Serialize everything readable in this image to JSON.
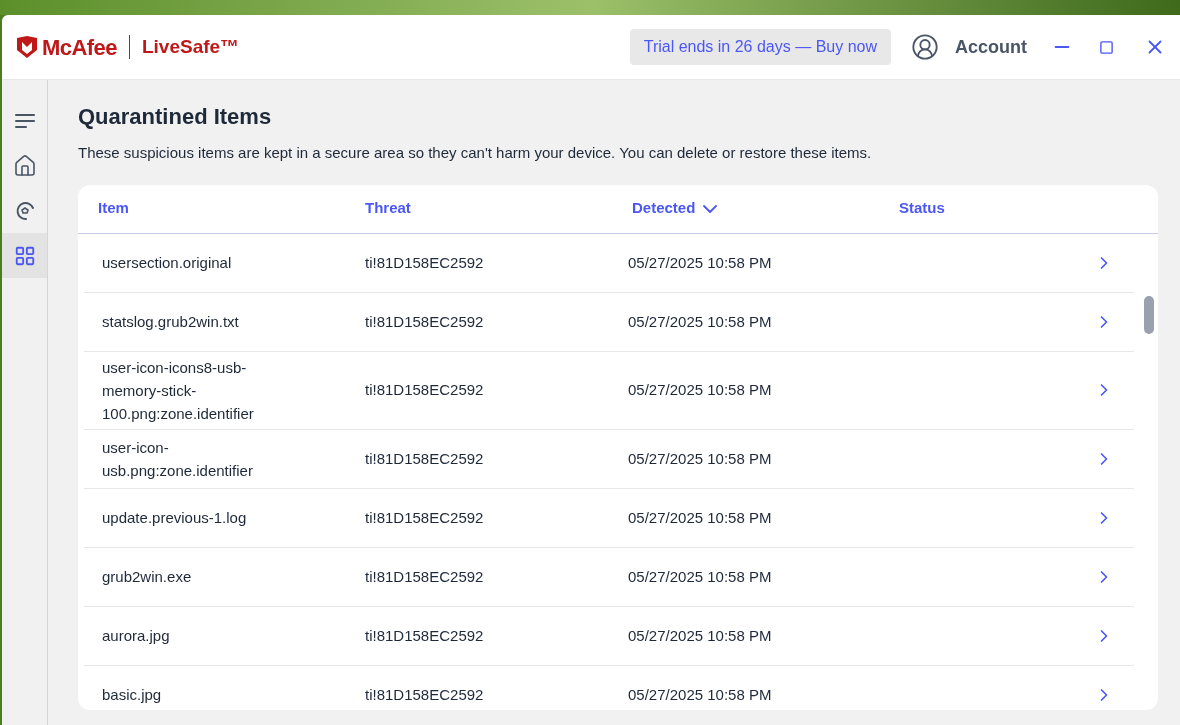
{
  "app": {
    "brand": "McAfee",
    "product": "LiveSafe™"
  },
  "header": {
    "trial": "Trial ends in 26 days — Buy now",
    "account": "Account"
  },
  "sidebar": {
    "items": [
      {
        "kind": "menu",
        "selected": false
      },
      {
        "kind": "home",
        "selected": false
      },
      {
        "kind": "protection",
        "selected": false
      },
      {
        "kind": "grid",
        "selected": true
      }
    ]
  },
  "page": {
    "title": "Quarantined Items",
    "description": "These suspicious items are kept in a secure area so they can't harm your device. You can delete or restore these items."
  },
  "table": {
    "columns": [
      {
        "label": "Item",
        "sorted": false
      },
      {
        "label": "Threat",
        "sorted": false
      },
      {
        "label": "Detected",
        "sorted": true
      },
      {
        "label": "Status",
        "sorted": false
      }
    ],
    "rows": [
      {
        "item": "usersection.original",
        "threat": "ti!81D158EC2592",
        "detected": "05/27/2025 10:58 PM"
      },
      {
        "item": "statslog.grub2win.txt",
        "threat": "ti!81D158EC2592",
        "detected": "05/27/2025 10:58 PM"
      },
      {
        "item": "user-icon-icons8-usb-memory-stick-100.png:zone.identifier",
        "threat": "ti!81D158EC2592",
        "detected": "05/27/2025 10:58 PM"
      },
      {
        "item": "user-icon-usb.png:zone.identifier",
        "threat": "ti!81D158EC2592",
        "detected": "05/27/2025 10:58 PM"
      },
      {
        "item": "update.previous-1.log",
        "threat": "ti!81D158EC2592",
        "detected": "05/27/2025 10:58 PM"
      },
      {
        "item": "grub2win.exe",
        "threat": "ti!81D158EC2592",
        "detected": "05/27/2025 10:58 PM"
      },
      {
        "item": "aurora.jpg",
        "threat": "ti!81D158EC2592",
        "detected": "05/27/2025 10:58 PM"
      },
      {
        "item": "basic.jpg",
        "threat": "ti!81D158EC2592",
        "detected": "05/27/2025 10:58 PM"
      }
    ]
  }
}
